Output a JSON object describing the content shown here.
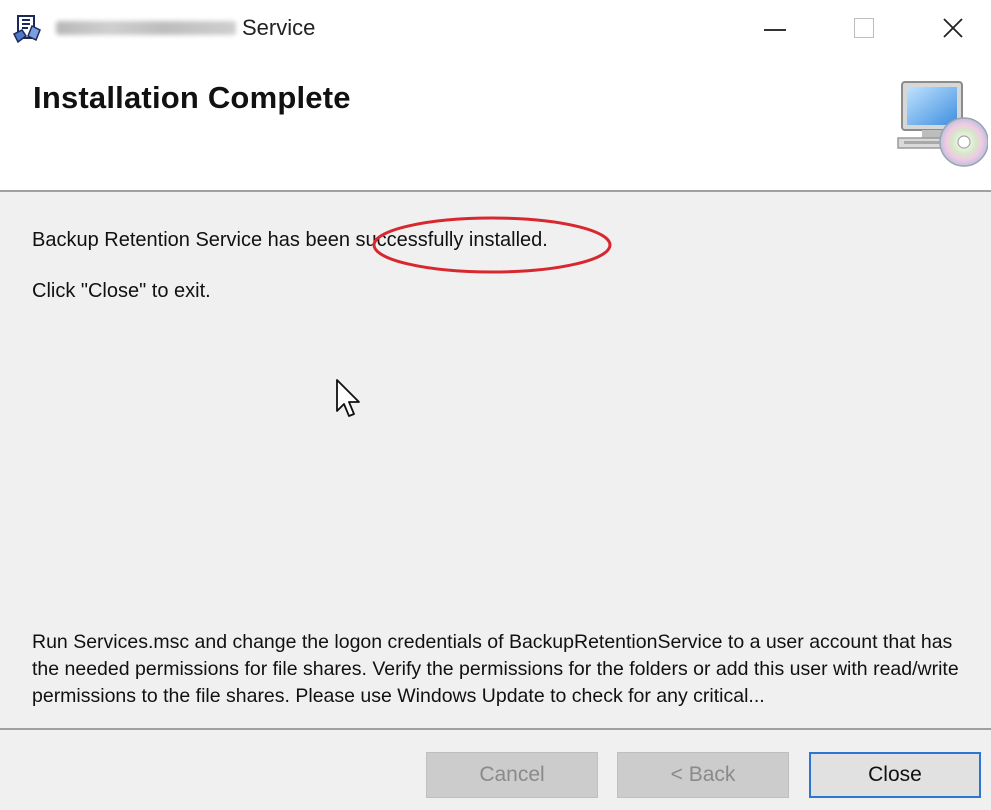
{
  "window": {
    "title_suffix": "Service",
    "controls": {
      "minimize": "minimize",
      "maximize": "maximize",
      "close": "✕"
    }
  },
  "banner": {
    "title": "Installation Complete",
    "icon": "computer-cd-icon"
  },
  "content": {
    "line_prefix": "Backup Retention Service has been ",
    "line_highlight": "successfully installed.",
    "exit_instruction": "Click \"Close\" to exit.",
    "note": "Run Services.msc and change the logon credentials of BackupRetentionService to a user account that has the needed permissions for file shares.  Verify the permissions for the folders or add this user with read/write permissions to the file shares. Please use Windows Update to check for any critical..."
  },
  "buttons": {
    "cancel": "Cancel",
    "back": "< Back",
    "close": "Close"
  },
  "colors": {
    "annotation": "#d8282f",
    "focus_border": "#2a76d2",
    "content_bg": "#f0f0f0"
  }
}
